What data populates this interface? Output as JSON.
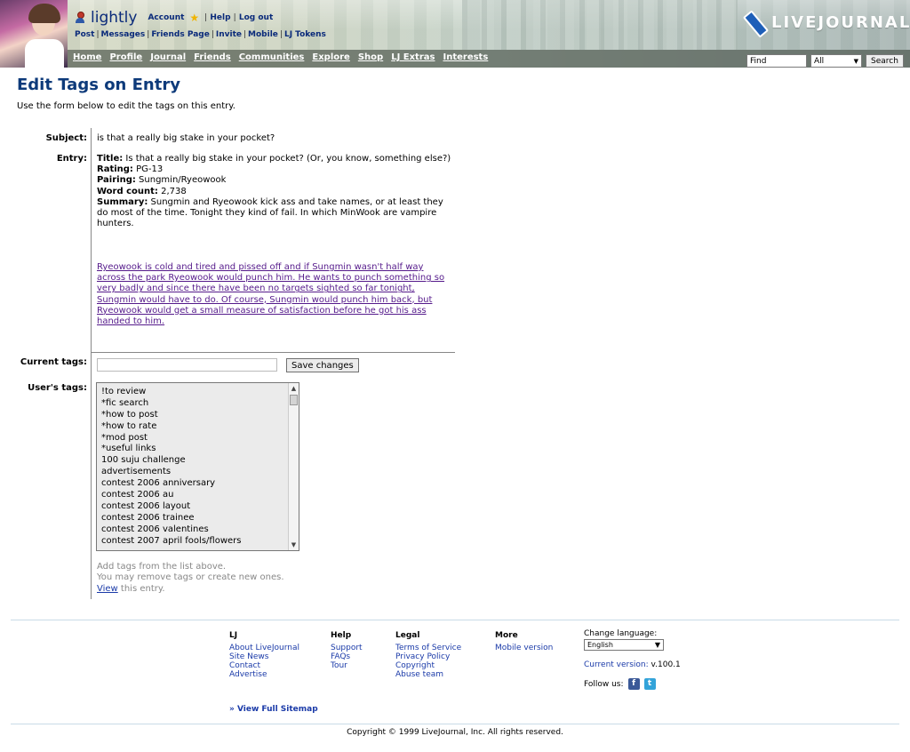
{
  "header": {
    "username": "lightly",
    "account_label": "Account",
    "help_label": "Help",
    "logout_label": "Log out",
    "sub_nav": [
      "Post",
      "Messages",
      "Friends Page",
      "Invite",
      "Mobile",
      "LJ Tokens"
    ],
    "main_nav": [
      "Home",
      "Profile",
      "Journal",
      "Friends",
      "Communities",
      "Explore",
      "Shop",
      "LJ Extras",
      "Interests"
    ],
    "logo_text": "LIVEJOURNAL",
    "search": {
      "input_value": "Find",
      "select_value": "All",
      "button_label": "Search"
    }
  },
  "page": {
    "title": "Edit Tags on Entry",
    "intro": "Use the form below to edit the tags on this entry.",
    "subject_label": "Subject:",
    "subject_value": "is that a really big stake in your pocket?",
    "entry_label": "Entry:",
    "entry": {
      "title_label": "Title:",
      "title_value": " Is that a really big stake in your pocket? (Or, you know, something else?)",
      "rating_label": "Rating:",
      "rating_value": " PG-13",
      "pairing_label": "Pairing:",
      "pairing_value": " Sungmin/Ryeowook",
      "wordcount_label": "Word count:",
      "wordcount_value": " 2,738",
      "summary_label": "Summary:",
      "summary_value": " Sungmin and Ryeowook kick ass and take names, or at least they do most of the time. Tonight they kind of fail. In which MinWook are vampire hunters.",
      "link_text": "Ryeowook is cold and tired and pissed off and if Sungmin wasn't half way across the park Ryeowook would punch him. He wants to punch something so very badly and since there have been no targets sighted so far tonight, Sungmin would have to do. Of course, Sungmin would punch him back, but Ryeowook would get a small measure of satisfaction before he got his ass handed to him."
    },
    "current_tags_label": "Current tags:",
    "current_tags_value": "",
    "save_label": "Save changes",
    "users_tags_label": "User's tags:",
    "users_tags": [
      "!to review",
      "*fic search",
      "*how to post",
      "*how to rate",
      "*mod post",
      "*useful links",
      "100 suju challenge",
      "advertisements",
      "contest 2006 anniversary",
      "contest 2006 au",
      "contest 2006 layout",
      "contest 2006 trainee",
      "contest 2006 valentines",
      "contest 2007 april fools/flowers"
    ],
    "hint_line1": "Add tags from the list above.",
    "hint_line2": "You may remove tags or create new ones.",
    "hint_view": "View",
    "hint_rest": " this entry."
  },
  "footer": {
    "columns": [
      {
        "heading": "LJ",
        "links": [
          "About LiveJournal",
          "Site News",
          "Contact",
          "Advertise"
        ]
      },
      {
        "heading": "Help",
        "links": [
          "Support",
          "FAQs",
          "Tour"
        ]
      },
      {
        "heading": "Legal",
        "links": [
          "Terms of Service",
          "Privacy Policy",
          "Copyright",
          "Abuse team"
        ]
      },
      {
        "heading": "More",
        "links": [
          "Mobile version"
        ]
      }
    ],
    "change_language_label": "Change language:",
    "language_value": "English",
    "version_label": "Current version:",
    "version_value": " v.100.1",
    "follow_label": "Follow us:",
    "sitemap_label": "» View Full Sitemap",
    "copyright": "Copyright © 1999 LiveJournal, Inc. All rights reserved."
  }
}
